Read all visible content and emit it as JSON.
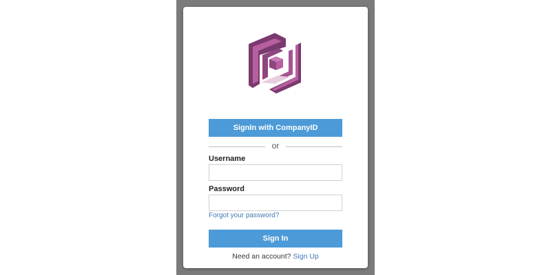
{
  "login": {
    "company_signin_label": "SignIn with CompanyID",
    "or_text": "or",
    "username_label": "Username",
    "username_value": "",
    "password_label": "Password",
    "password_value": "",
    "forgot_password": "Forgot your password?",
    "signin_label": "Sign In",
    "need_account_text": "Need an account?",
    "signup_link": "Sign Up"
  },
  "logo": {
    "icon": "amazon-cognito-logo-icon"
  },
  "colors": {
    "button_blue": "#4c9bd8",
    "link_blue": "#3e78b2",
    "backdrop_gray": "#7b7b7b",
    "logo_purple_dark": "#7b3a6f",
    "logo_purple_light": "#b85f9f"
  }
}
